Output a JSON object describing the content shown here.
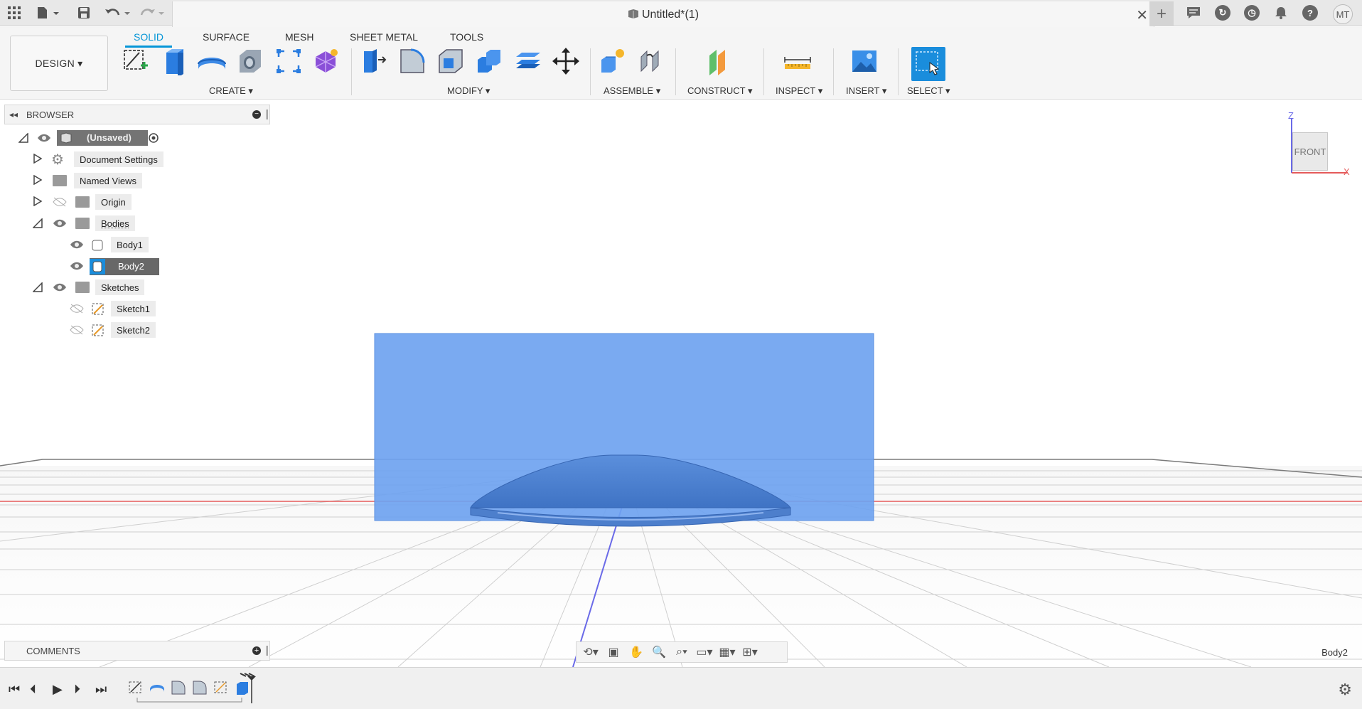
{
  "titlebar": {
    "doc_title": "Untitled*(1)",
    "avatar_initials": "MT"
  },
  "toolbar": {
    "workspace": "DESIGN ▾",
    "tabs": [
      "SOLID",
      "SURFACE",
      "MESH",
      "SHEET METAL",
      "TOOLS"
    ],
    "groups": {
      "create": "CREATE ▾",
      "modify": "MODIFY ▾",
      "assemble": "ASSEMBLE ▾",
      "construct": "CONSTRUCT ▾",
      "inspect": "INSPECT ▾",
      "insert": "INSERT ▾",
      "select": "SELECT ▾"
    }
  },
  "browser": {
    "title": "BROWSER",
    "items": [
      {
        "label": "(Unsaved)"
      },
      {
        "label": "Document Settings"
      },
      {
        "label": "Named Views"
      },
      {
        "label": "Origin"
      },
      {
        "label": "Bodies"
      },
      {
        "label": "Body1"
      },
      {
        "label": "Body2"
      },
      {
        "label": "Sketches"
      },
      {
        "label": "Sketch1"
      },
      {
        "label": "Sketch2"
      }
    ]
  },
  "viewcube": {
    "face": "FRONT",
    "axis_z": "Z",
    "axis_x": "X"
  },
  "comments": {
    "title": "COMMENTS"
  },
  "status": {
    "selection": "Body2"
  },
  "colors": {
    "accent": "#0696d7",
    "body_blue": "#6fa3f0",
    "selected_row": "#686868"
  }
}
